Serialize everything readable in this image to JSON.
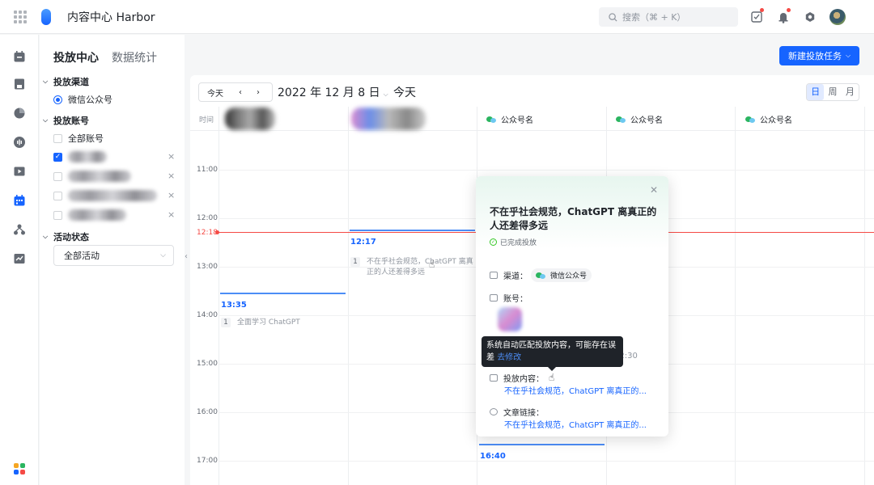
{
  "app": {
    "title": "内容中心 Harbor"
  },
  "search": {
    "placeholder": "搜索（⌘ + K）"
  },
  "sidebar": {
    "tabs": [
      {
        "label": "投放中心"
      },
      {
        "label": "数据统计"
      }
    ],
    "channel_section": "投放渠道",
    "channel_option": "微信公众号",
    "account_section": "投放账号",
    "all_accounts": "全部账号",
    "activity_section": "活动状态",
    "activity_select": "全部活动"
  },
  "toolbar": {
    "new_task": "新建投放任务",
    "today": "今天",
    "date": "2022 年 12 月 8 日",
    "today_label": "今天",
    "views": [
      {
        "label": "日"
      },
      {
        "label": "周"
      },
      {
        "label": "月"
      }
    ]
  },
  "calendar": {
    "time_label": "时间",
    "column_name": "公众号名",
    "hours": [
      "11:00",
      "12:00",
      "13:00",
      "14:00",
      "15:00",
      "16:00",
      "17:00"
    ],
    "now_time": "12:18",
    "events": [
      {
        "time": "12:17",
        "num": "1",
        "text": "不在乎社会规范，ChatGPT 离真正的人还差得多远"
      },
      {
        "time": "13:35",
        "num": "1",
        "text": "全面学习 ChatGPT"
      },
      {
        "time": "16:40"
      }
    ]
  },
  "popover": {
    "title": "不在乎社会规范，ChatGPT 离真正的人还差得多远",
    "status": "已完成投放",
    "channel_label": "渠道：",
    "channel_value": "微信公众号",
    "account_label": "账号：",
    "date_partial": "月 30 日 12:20 - 12:30",
    "content_label": "投放内容：",
    "content_value": "不在乎社会规范，ChatGPT 离真正的...",
    "link_label": "文章链接：",
    "link_value": "不在乎社会规范，ChatGPT 离真正的..."
  },
  "tooltip": {
    "text": "系统自动匹配投放内容，可能存在误差",
    "link": "去修改"
  },
  "colors": {
    "accent": "#1664ff",
    "now_line": "#f54a45",
    "wechat_green": "#2bb560"
  }
}
